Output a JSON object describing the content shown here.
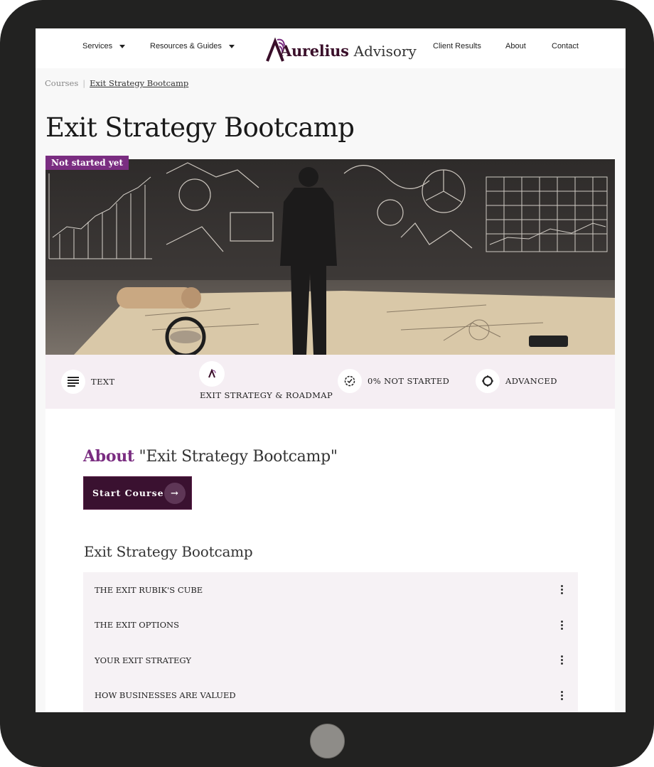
{
  "nav": {
    "services": "Services",
    "resources": "Resources & Guides",
    "brand_bold": "Aurelius",
    "brand_light": "Advisory",
    "client_results": "Client Results",
    "about": "About",
    "contact": "Contact"
  },
  "breadcrumb": {
    "parent": "Courses",
    "separator": "|",
    "current": "Exit Strategy Bootcamp"
  },
  "course": {
    "title": "Exit Strategy Bootcamp",
    "status_tag": "Not started yet",
    "hero_icon": "man-at-chalkboard-image"
  },
  "info": {
    "type": "TEXT",
    "category": "EXIT STRATEGY & ROADMAP",
    "progress": "0% NOT STARTED",
    "level": "ADVANCED"
  },
  "about": {
    "label": "About",
    "quoted_title": "\"Exit Strategy Bootcamp\"",
    "start_button": "Start Course",
    "arrow": "→"
  },
  "curriculum": {
    "title": "Exit Strategy Bootcamp",
    "modules": [
      "THE EXIT RUBIK'S CUBE",
      "THE EXIT OPTIONS",
      "YOUR EXIT STRATEGY",
      "HOW BUSINESSES ARE VALUED"
    ]
  },
  "colors": {
    "accent": "#7a2d81",
    "button": "#3a1130",
    "infobar": "#f5eef3",
    "frame": "#222221"
  }
}
